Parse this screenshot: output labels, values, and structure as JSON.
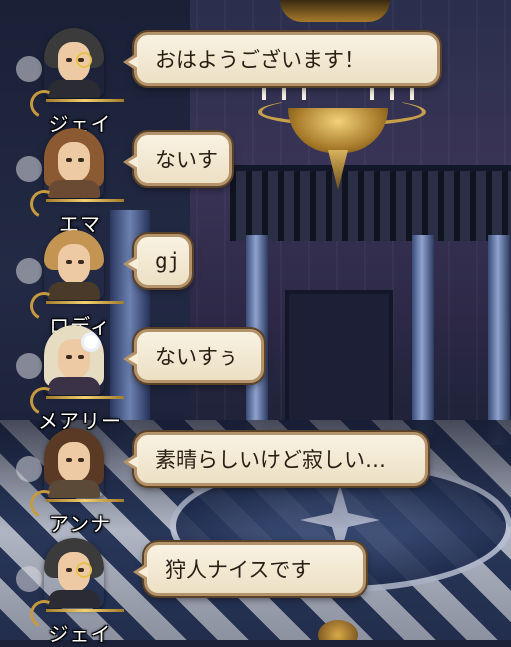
{
  "messages": [
    {
      "speaker": "ジェイ",
      "text": "おはようございます！"
    },
    {
      "speaker": "エマ",
      "text": "ないす"
    },
    {
      "speaker": "ロディ",
      "text": "gj"
    },
    {
      "speaker": "メアリー",
      "text": "ないすぅ"
    },
    {
      "speaker": "アンナ",
      "text": "素晴らしいけど寂しい…"
    },
    {
      "speaker": "ジェイ",
      "text": "狩人ナイスです"
    }
  ],
  "colors": {
    "bubble_fill": "#f6eedb",
    "bubble_border": "#b4936a",
    "name_text": "#ffffff",
    "message_text": "#2a1e14"
  },
  "avatars": [
    "gentleman-monocle-avatar",
    "brown-hair-girl-avatar",
    "blond-man-avatar",
    "platinum-hair-girl-avatar",
    "braided-woman-avatar",
    "gentleman-monocle-avatar"
  ]
}
